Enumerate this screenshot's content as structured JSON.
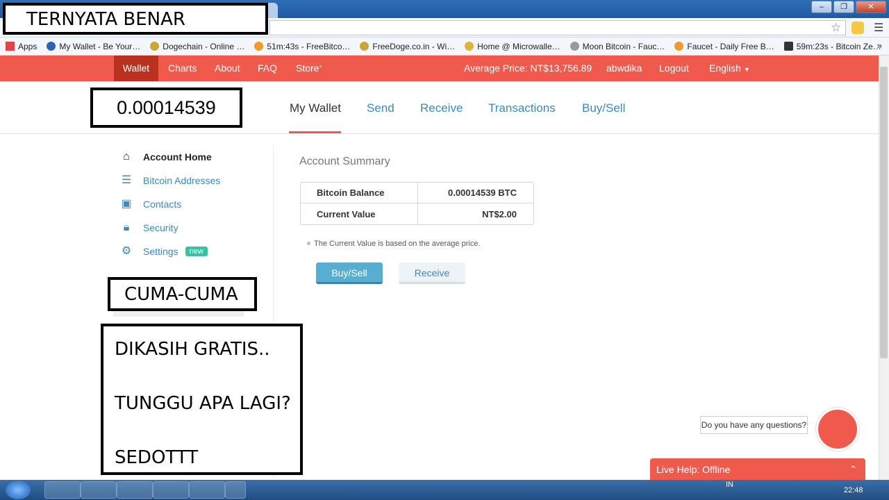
{
  "overlays": {
    "title": "TERNYATA BENAR",
    "balance": "0.00014539",
    "cuma": "CUMA-CUMA",
    "line1": "DIKASIH GRATIS..",
    "line2": "TUNGGU APA LAGI?",
    "line3": "SEDOTTT"
  },
  "bookmarks": [
    {
      "label": "Apps",
      "color": "#d44"
    },
    {
      "label": "My Wallet - Be Your…",
      "color": "#2c63b8"
    },
    {
      "label": "Dogechain - Online …",
      "color": "#c9a53a"
    },
    {
      "label": "51m:43s - FreeBitco…",
      "color": "#f09a2a"
    },
    {
      "label": "FreeDoge.co.in - Wi…",
      "color": "#c9a53a"
    },
    {
      "label": "Home @ Microwalle…",
      "color": "#e0b43c"
    },
    {
      "label": "Moon Bitcoin - Fauc…",
      "color": "#999"
    },
    {
      "label": "Faucet - Daily Free B…",
      "color": "#f09a2a"
    },
    {
      "label": "59m:23s - Bitcoin Ze…",
      "color": "#333"
    }
  ],
  "topnav": {
    "wallet": "Wallet",
    "charts": "Charts",
    "about": "About",
    "faq": "FAQ",
    "store": "Store",
    "store_star": "*",
    "average_price": "Average Price: NT$13,756.89",
    "username": "abwdika",
    "logout": "Logout",
    "language": "English"
  },
  "tabs": {
    "my_wallet": "My Wallet",
    "send": "Send",
    "receive": "Receive",
    "transactions": "Transactions",
    "buysell": "Buy/Sell"
  },
  "sidebar": {
    "home": "Account Home",
    "addresses": "Bitcoin Addresses",
    "contacts": "Contacts",
    "security": "Security",
    "settings": "Settings",
    "badge": "new"
  },
  "summary": {
    "title": "Account Summary",
    "balance_label": "Bitcoin Balance",
    "balance_value": "0.00014539 BTC",
    "value_label": "Current Value",
    "value_value": "NT$2.00",
    "note": "The Current Value is based on the average price.",
    "btn_buysell": "Buy/Sell",
    "btn_receive": "Receive"
  },
  "chat": {
    "question": "Do you have any questions?",
    "bar": "Live Help: Offline"
  },
  "taskbar": {
    "lang": "IN",
    "clock": "22:48"
  },
  "colors": {
    "accent": "#ef5a4c",
    "link": "#3a8ac0",
    "badge": "#38c2a3"
  }
}
